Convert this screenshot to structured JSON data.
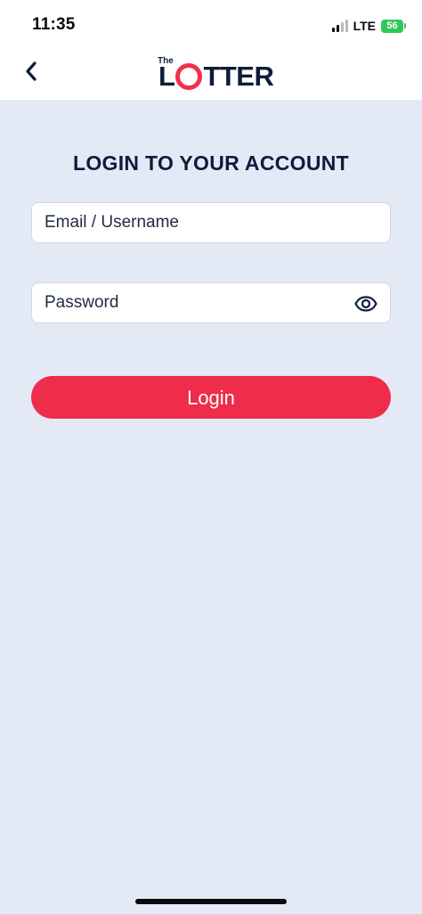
{
  "status_bar": {
    "time": "11:35",
    "network": "LTE",
    "battery": "56"
  },
  "header": {
    "back_icon": "chevron-left-icon",
    "logo_small": "The",
    "logo_left": "L",
    "logo_right": "TTER"
  },
  "login": {
    "title": "LOGIN TO YOUR ACCOUNT",
    "email_placeholder": "Email / Username",
    "email_value": "",
    "password_placeholder": "Password",
    "password_value": "",
    "password_toggle_icon": "eye-icon",
    "submit_label": "Login"
  },
  "colors": {
    "background": "#e3eaf6",
    "brand_navy": "#0e1c3b",
    "accent_red": "#f02c4b",
    "battery_green": "#33c759"
  }
}
